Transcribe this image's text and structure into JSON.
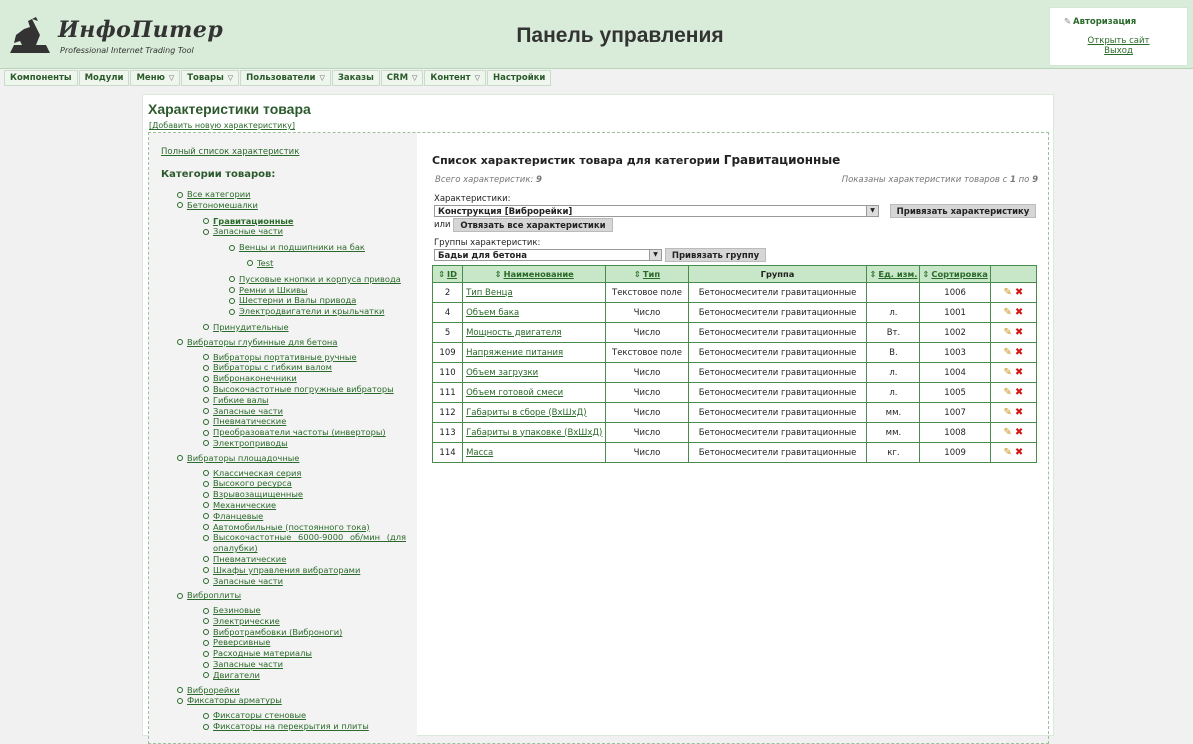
{
  "header": {
    "logo_name": "ИнфоПитер",
    "logo_sub": "Professional Internet Trading Tool",
    "title": "Панель управления"
  },
  "auth": {
    "title": "Авторизация",
    "open_site": "Открыть сайт",
    "logout": "Выход"
  },
  "menu": [
    {
      "label": "Компоненты",
      "dropdown": false
    },
    {
      "label": "Модули",
      "dropdown": false
    },
    {
      "label": "Меню",
      "dropdown": true
    },
    {
      "label": "Товары",
      "dropdown": true
    },
    {
      "label": "Пользователи",
      "dropdown": true
    },
    {
      "label": "Заказы",
      "dropdown": false
    },
    {
      "label": "CRM",
      "dropdown": true
    },
    {
      "label": "Контент",
      "dropdown": true
    },
    {
      "label": "Настройки",
      "dropdown": false
    }
  ],
  "page": {
    "title": "Характеристики товара",
    "add_link": "[Добавить новую характеристику]"
  },
  "sidebar": {
    "full_list": "Полный список характеристик",
    "categories_title": "Категории товаров:",
    "tree": [
      {
        "label": "Все категории",
        "level": 0
      },
      {
        "label": "Бетономешалки",
        "level": 0
      },
      {
        "label": "Гравитационные",
        "level": 1,
        "current": true,
        "gap": 5
      },
      {
        "label": "Запасные части",
        "level": 1
      },
      {
        "label": "Венцы и подшипники на бак",
        "level": 2,
        "gap": 5
      },
      {
        "label": "Test",
        "level": 3,
        "gap": 5
      },
      {
        "label": "Пусковые кнопки и корпуса привода",
        "level": 2,
        "gap": 5
      },
      {
        "label": "Ремни и Шкивы",
        "level": 2
      },
      {
        "label": "Шестерни и Валы привода",
        "level": 2
      },
      {
        "label": "Электродвигатели и крыльчатки",
        "level": 2
      },
      {
        "label": "Принудительные",
        "level": 1,
        "gap": 5
      },
      {
        "label": "Вибраторы глубинные для бетона",
        "level": 0,
        "gap": 4
      },
      {
        "label": "Вибраторы портативные ручные",
        "level": 1,
        "gap": 4
      },
      {
        "label": "Вибраторы с гибким валом",
        "level": 1
      },
      {
        "label": "Вибронаконечники",
        "level": 1
      },
      {
        "label": "Высокочастотные погружные вибраторы",
        "level": 1
      },
      {
        "label": "Гибкие валы",
        "level": 1
      },
      {
        "label": "Запасные части",
        "level": 1
      },
      {
        "label": "Пневматические",
        "level": 1
      },
      {
        "label": "Преобразователи частоты (инверторы)",
        "level": 1
      },
      {
        "label": "Электроприводы",
        "level": 1
      },
      {
        "label": "Вибраторы площадочные",
        "level": 0,
        "gap": 4
      },
      {
        "label": "Классическая серия",
        "level": 1,
        "gap": 4
      },
      {
        "label": "Высокого ресурса",
        "level": 1
      },
      {
        "label": "Взрывозащищенные",
        "level": 1
      },
      {
        "label": "Механические",
        "level": 1
      },
      {
        "label": "Фланцевые",
        "level": 1
      },
      {
        "label": "Автомобильные (постоянного тока)",
        "level": 1
      },
      {
        "label": "Высокочастотные 6000-9000 об/мин (для опалубки)",
        "level": 1,
        "wrap": true
      },
      {
        "label": "Пневматические",
        "level": 1
      },
      {
        "label": "Шкафы управления вибраторами",
        "level": 1
      },
      {
        "label": "Запасные части",
        "level": 1
      },
      {
        "label": "Виброплиты",
        "level": 0,
        "gap": 4
      },
      {
        "label": "Безиновые",
        "level": 1,
        "gap": 4
      },
      {
        "label": "Электрические",
        "level": 1
      },
      {
        "label": "Вибротрамбовки (Виброноги)",
        "level": 1
      },
      {
        "label": "Реверсивные",
        "level": 1
      },
      {
        "label": "Расходные материалы",
        "level": 1
      },
      {
        "label": "Запасные части",
        "level": 1
      },
      {
        "label": "Двигатели",
        "level": 1
      },
      {
        "label": "Виброрейки",
        "level": 0,
        "gap": 4
      },
      {
        "label": "Фиксаторы арматуры",
        "level": 0
      },
      {
        "label": "Фиксаторы стеновые",
        "level": 1,
        "gap": 4
      },
      {
        "label": "Фиксаторы на перекрытия и плиты",
        "level": 1
      }
    ]
  },
  "main": {
    "list_title": "Список характеристик товара для категории",
    "category": "Гравитационные",
    "total_label": "Всего характеристик:",
    "total": "9",
    "shown_prefix": "Показаны характеристики товаров с",
    "shown_from": "1",
    "shown_mid": "по",
    "shown_to": "9",
    "characteristics_label": "Характеристики:",
    "characteristics_value": "Конструкция [Виброрейки]",
    "bind_char_button": "Привязать характеристику",
    "or_label": "или",
    "unbind_all_button": "Отвязать все характеристики",
    "groups_label": "Группы характеристик:",
    "groups_value": "Бадьи для бетона",
    "bind_group_button": "Привязать группу"
  },
  "table": {
    "headers": {
      "id": "ID",
      "name": "Наименование",
      "type": "Тип",
      "group": "Группа",
      "unit": "Ед. изм.",
      "sort": "Сортировка"
    },
    "rows": [
      {
        "id": "2",
        "name": "Тип Венца",
        "type": "Текстовое поле",
        "group": "Бетоносмесители гравитационные",
        "unit": "",
        "sort": "1006"
      },
      {
        "id": "4",
        "name": "Объем бака",
        "type": "Число",
        "group": "Бетоносмесители гравитационные",
        "unit": "л.",
        "sort": "1001"
      },
      {
        "id": "5",
        "name": "Мощность двигателя",
        "type": "Число",
        "group": "Бетоносмесители гравитационные",
        "unit": "Вт.",
        "sort": "1002"
      },
      {
        "id": "109",
        "name": "Напряжение питания",
        "type": "Текстовое поле",
        "group": "Бетоносмесители гравитационные",
        "unit": "В.",
        "sort": "1003"
      },
      {
        "id": "110",
        "name": "Объем загрузки",
        "type": "Число",
        "group": "Бетоносмесители гравитационные",
        "unit": "л.",
        "sort": "1004"
      },
      {
        "id": "111",
        "name": "Объем готовой смеси",
        "type": "Число",
        "group": "Бетоносмесители гравитационные",
        "unit": "л.",
        "sort": "1005"
      },
      {
        "id": "112",
        "name": "Габариты в сборе (ВхШхД)",
        "type": "Число",
        "group": "Бетоносмесители гравитационные",
        "unit": "мм.",
        "sort": "1007"
      },
      {
        "id": "113",
        "name": "Габариты в упаковке (ВхШхД)",
        "type": "Число",
        "group": "Бетоносмесители гравитационные",
        "unit": "мм.",
        "sort": "1008"
      },
      {
        "id": "114",
        "name": "Масса",
        "type": "Число",
        "group": "Бетоносмесители гравитационные",
        "unit": "кг.",
        "sort": "1009"
      }
    ]
  }
}
